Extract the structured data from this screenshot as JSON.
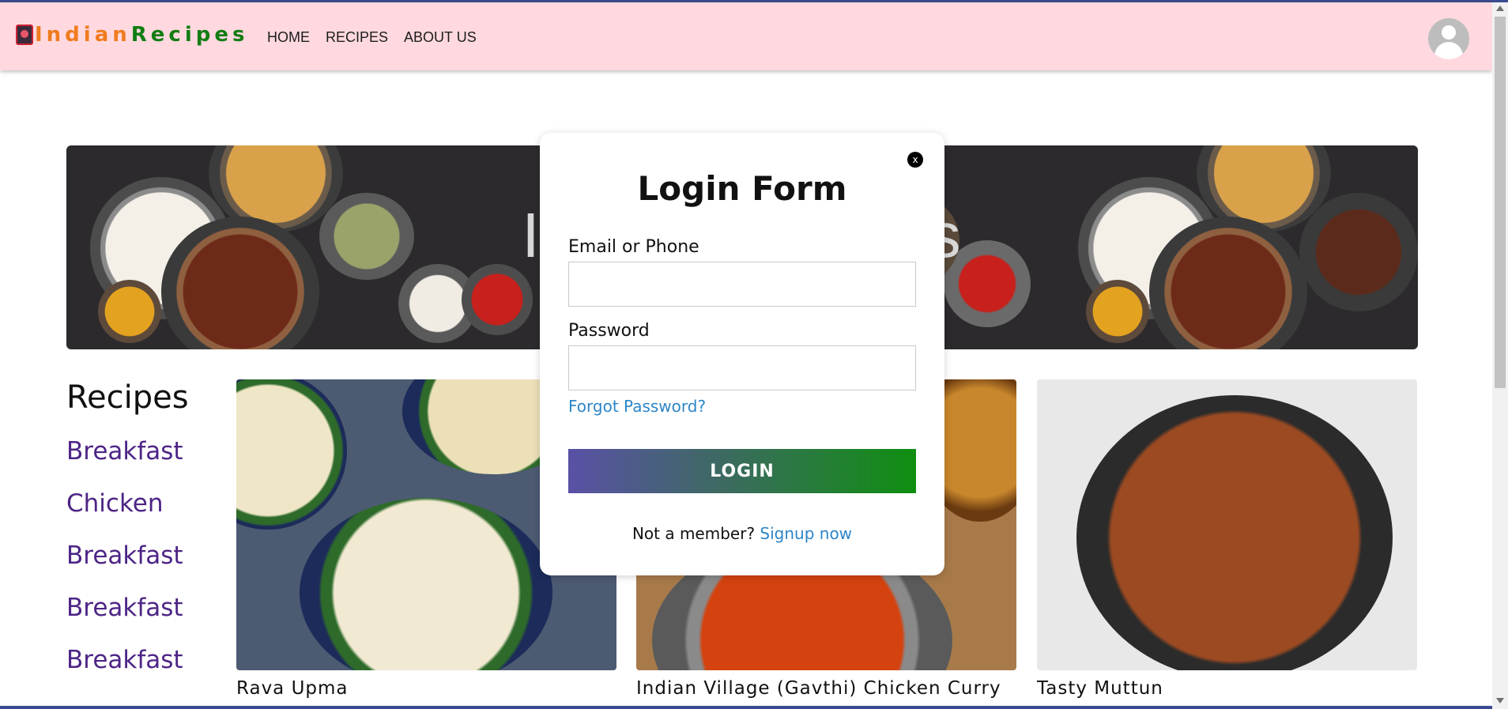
{
  "brand": {
    "part1": "Indian",
    "part2": "Recipes"
  },
  "nav": {
    "items": [
      "HOME",
      "RECIPES",
      "ABOUT US"
    ]
  },
  "banner": {
    "title": "Indian Recipes"
  },
  "sidebar": {
    "title": "Recipes",
    "items": [
      "Breakfast",
      "Chicken",
      "Breakfast",
      "Breakfast",
      "Breakfast"
    ]
  },
  "cards": [
    {
      "title": "Rava Upma"
    },
    {
      "title": "Indian Village (Gavthi) Chicken Curry"
    },
    {
      "title": "Tasty Muttun"
    }
  ],
  "login": {
    "title": "Login Form",
    "close": "x",
    "email_label": "Email or Phone",
    "email_value": "",
    "password_label": "Password",
    "password_value": "",
    "forgot": "Forgot Password?",
    "button": "LOGIN",
    "not_member": "Not a member?",
    "signup": "Signup now"
  },
  "colors": {
    "navbar_bg": "#ffd9df",
    "brand_orange": "#f07b1d",
    "brand_green": "#127d13",
    "sidebar_link": "#4d2586",
    "link_blue": "#2d86c9"
  }
}
